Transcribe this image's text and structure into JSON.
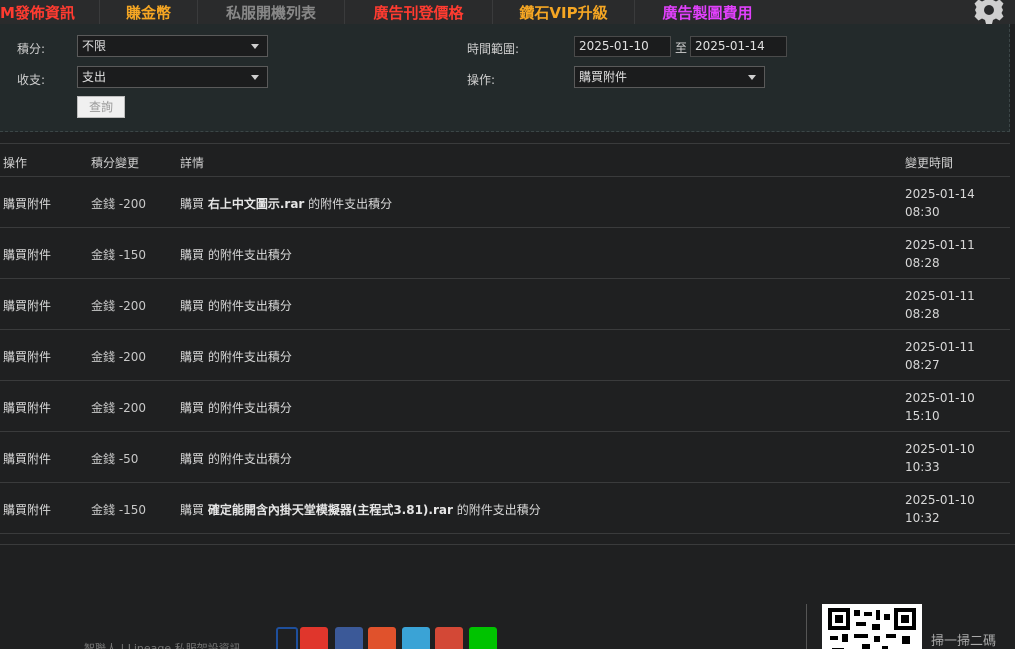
{
  "nav": {
    "items": [
      {
        "label": "M發佈資訊",
        "color": "#ff3b30"
      },
      {
        "label": "賺金幣",
        "color": "#f5a623"
      },
      {
        "label": "私服開機列表",
        "color": "#888888"
      },
      {
        "label": "廣告刊登價格",
        "color": "#ff3b30"
      },
      {
        "label": "鑽石VIP升級",
        "color": "#f5a623"
      },
      {
        "label": "廣告製圖費用",
        "color": "#e040fb"
      }
    ],
    "settings_icon": "gear-icon"
  },
  "filters": {
    "points_label": "積分:",
    "points_value": "不限",
    "income_label": "收支:",
    "income_value": "支出",
    "time_label": "時間範圍:",
    "date_from": "2025-01-10",
    "date_to_sep": "至",
    "date_to": "2025-01-14",
    "action_label": "操作:",
    "action_value": "購買附件",
    "query_button": "查詢"
  },
  "table": {
    "headers": {
      "op": "操作",
      "change": "積分變更",
      "detail": "詳情",
      "time": "變更時間"
    },
    "rows": [
      {
        "op": "購買附件",
        "change": "金錢 -200",
        "detail_pre": "購買",
        "detail_name": "右上中文圖示.rar",
        "detail_post": "的附件支出積分",
        "date": "2025-01-14",
        "clock": "08:30"
      },
      {
        "op": "購買附件",
        "change": "金錢 -150",
        "detail_pre": "購買",
        "detail_name": "",
        "detail_post": "的附件支出積分",
        "date": "2025-01-11",
        "clock": "08:28"
      },
      {
        "op": "購買附件",
        "change": "金錢 -200",
        "detail_pre": "購買",
        "detail_name": "",
        "detail_post": "的附件支出積分",
        "date": "2025-01-11",
        "clock": "08:28"
      },
      {
        "op": "購買附件",
        "change": "金錢 -200",
        "detail_pre": "購買",
        "detail_name": "",
        "detail_post": "的附件支出積分",
        "date": "2025-01-11",
        "clock": "08:27"
      },
      {
        "op": "購買附件",
        "change": "金錢 -200",
        "detail_pre": "購買",
        "detail_name": "",
        "detail_post": "的附件支出積分",
        "date": "2025-01-10",
        "clock": "15:10"
      },
      {
        "op": "購買附件",
        "change": "金錢 -50",
        "detail_pre": "購買",
        "detail_name": "",
        "detail_post": "的附件支出積分",
        "date": "2025-01-10",
        "clock": "10:33"
      },
      {
        "op": "購買附件",
        "change": "金錢 -150",
        "detail_pre": "購買",
        "detail_name": "確定能開含內掛天堂模擬器(主程式3.81).rar",
        "detail_post": "的附件支出積分",
        "date": "2025-01-10",
        "clock": "10:32"
      }
    ]
  },
  "footer": {
    "text": "智聯人 | Lineage 私服架設資訊",
    "social_icons": [
      {
        "name": "weibo-icon",
        "color": "#1e4f9c"
      },
      {
        "name": "sina-icon",
        "color": "#e0362c"
      },
      {
        "name": "facebook-icon",
        "color": "#3b5998"
      },
      {
        "name": "plurk-icon",
        "color": "#e0522c"
      },
      {
        "name": "twitter-icon",
        "color": "#3aa3d6"
      },
      {
        "name": "googleplus-icon",
        "color": "#d34836"
      },
      {
        "name": "line-icon",
        "color": "#00c300"
      }
    ],
    "qr_label": "掃一掃二碼"
  }
}
